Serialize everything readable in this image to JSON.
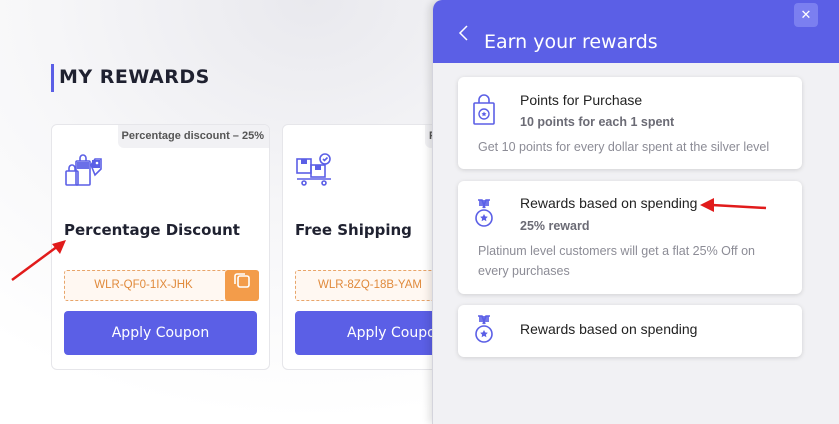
{
  "page": {
    "title": "MY REWARDS"
  },
  "cards": [
    {
      "badge": "Percentage discount – 25%",
      "heading": "Percentage Discount",
      "code": "WLR-QF0-1IX-JHK",
      "apply_label": "Apply Coupon",
      "icon": "shopping-bags-icon"
    },
    {
      "badge": "Fr",
      "heading": "Free Shipping",
      "code": "WLR-8ZQ-18B-YAM",
      "apply_label": "Apply Coupo",
      "icon": "delivery-boxes-icon"
    }
  ],
  "panel": {
    "title": "Earn your rewards",
    "close_label": "✕",
    "rewards": [
      {
        "title": "Points for Purchase",
        "subtitle": "10 points for each 1 spent",
        "description": "Get 10 points for every dollar spent at the silver level",
        "icon": "shopping-bag-icon"
      },
      {
        "title": "Rewards based on spending",
        "subtitle": "25% reward",
        "description": "Platinum level customers will get a flat 25% Off on every purchases",
        "icon": "medal-icon"
      },
      {
        "title": "Rewards based on spending",
        "icon": "medal-icon"
      }
    ]
  },
  "colors": {
    "accent": "#5b5fe6",
    "coupon_orange": "#f39c4a",
    "annotation_red": "#e11b1b"
  }
}
